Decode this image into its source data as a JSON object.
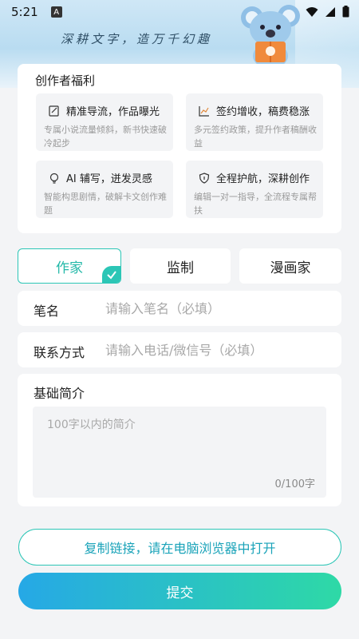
{
  "status_bar": {
    "time": "5:21",
    "badge": "A"
  },
  "header": {
    "slogan": "深耕文字，造万千幻趣"
  },
  "benefits": {
    "title": "创作者福利",
    "items": [
      {
        "icon": "edit-icon",
        "title": "精准导流，作品曝光",
        "desc": "专属小说流量倾斜，新书快速破冷起步"
      },
      {
        "icon": "chart-icon",
        "title": "签约增收，稿费稳涨",
        "desc": "多元签约政策，提升作者稿酬收益"
      },
      {
        "icon": "bulb-icon",
        "title": "AI 辅写，迸发灵感",
        "desc": "智能构思剧情，破解卡文创作难题"
      },
      {
        "icon": "shield-icon",
        "title": "全程护航，深耕创作",
        "desc": "编辑一对一指导，全流程专属帮扶"
      }
    ]
  },
  "roles": {
    "items": [
      "作家",
      "监制",
      "漫画家"
    ],
    "selected": "作家"
  },
  "form": {
    "pen_name": {
      "label": "笔名",
      "placeholder": "请输入笔名（必填）"
    },
    "contact": {
      "label": "联系方式",
      "placeholder": "请输入电话/微信号（必填）"
    },
    "intro": {
      "label": "基础简介",
      "placeholder": "100字以内的简介",
      "counter": "0/100字"
    }
  },
  "actions": {
    "copy_link": "复制链接，请在电脑浏览器中打开",
    "submit": "提交"
  },
  "colors": {
    "accent": "#2cc6b6",
    "gradient_start": "#26a8e6",
    "gradient_end": "#2ed9a6",
    "link_text": "#1aa3b9"
  }
}
